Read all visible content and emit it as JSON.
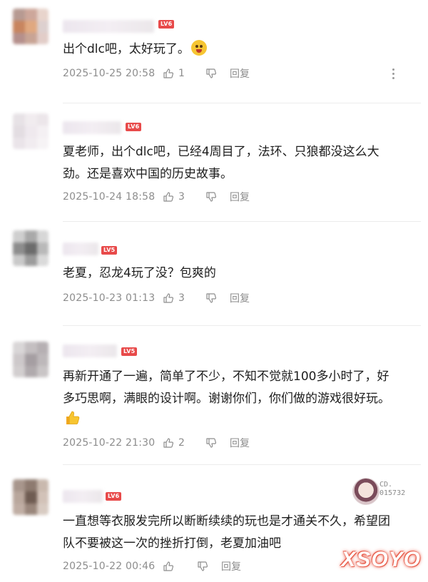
{
  "comments": [
    {
      "level": "LV6",
      "lines": [
        "出个dlc吧，太好玩了。"
      ],
      "emoji": "laughing-face-emoji",
      "time": "2025-10-25 20:58",
      "likes": "1",
      "reply": "回复",
      "avatar_colors": [
        "#b79a92",
        "#cda79b",
        "#e8d4cc",
        "#c8855f",
        "#e0a880",
        "#ddd0cf",
        "#b5908c",
        "#c8a495",
        "#e2cdc8"
      ]
    },
    {
      "level": "LV6",
      "lines": [
        "夏老师，出个dlc吧，已经4周目了，法环、只狼都没这么大",
        "劲。还是喜欢中国的历史故事。"
      ],
      "time": "2025-10-24 18:58",
      "likes": "3",
      "reply": "回复",
      "avatar_colors": [
        "#e7e2e6",
        "#f1ecef",
        "#ece6ea",
        "#e3dde2",
        "#efe9ee",
        "#f4f0f3",
        "#eae4e9",
        "#f1ecf0",
        "#f6f3f5"
      ]
    },
    {
      "level": "LV5",
      "lines": [
        "老夏，忍龙4玩了没？包爽的"
      ],
      "time": "2025-10-23 01:13",
      "likes": "3",
      "reply": "回复",
      "avatar_colors": [
        "#cfcfcf",
        "#a9a9a9",
        "#d7d7d7",
        "#8d8d8d",
        "#6c6c6c",
        "#b9b9b9",
        "#c9c9c9",
        "#9c9c9c",
        "#dadada"
      ]
    },
    {
      "level": "LV5",
      "lines": [
        "再新开通了一遍，简单了不少，不知不觉就100多小时了，好",
        "多巧思啊，满眼的设计啊。谢谢你们，你们做的游戏很好玩。"
      ],
      "thumb": "thumbs-up-emoji",
      "time": "2025-10-22 21:30",
      "likes": "2",
      "reply": "回复",
      "avatar_colors": [
        "#d9d6d7",
        "#c4bfc1",
        "#b6b0b3",
        "#cdc8ca",
        "#a59ea2",
        "#bdb8ba",
        "#d2cecf",
        "#b0aaad",
        "#c9c5c6"
      ]
    },
    {
      "level": "LV6",
      "lines": [
        "一直想等衣服发完所以断断续续的玩也是才通关不久，希望团",
        "队不要被这一次的挫折打倒，老夏加油吧"
      ],
      "time": "2025-10-22 00:46",
      "likes": "",
      "reply": "回复",
      "badge": [
        "CD.",
        "015732"
      ],
      "avatar_colors": [
        "#a8968c",
        "#8e7b70",
        "#c9b9ae",
        "#b9a79c",
        "#6f5c52",
        "#d2c2b8",
        "#c0aea4",
        "#9a877c",
        "#d8cbc2"
      ]
    }
  ],
  "watermark": "XSOYO"
}
